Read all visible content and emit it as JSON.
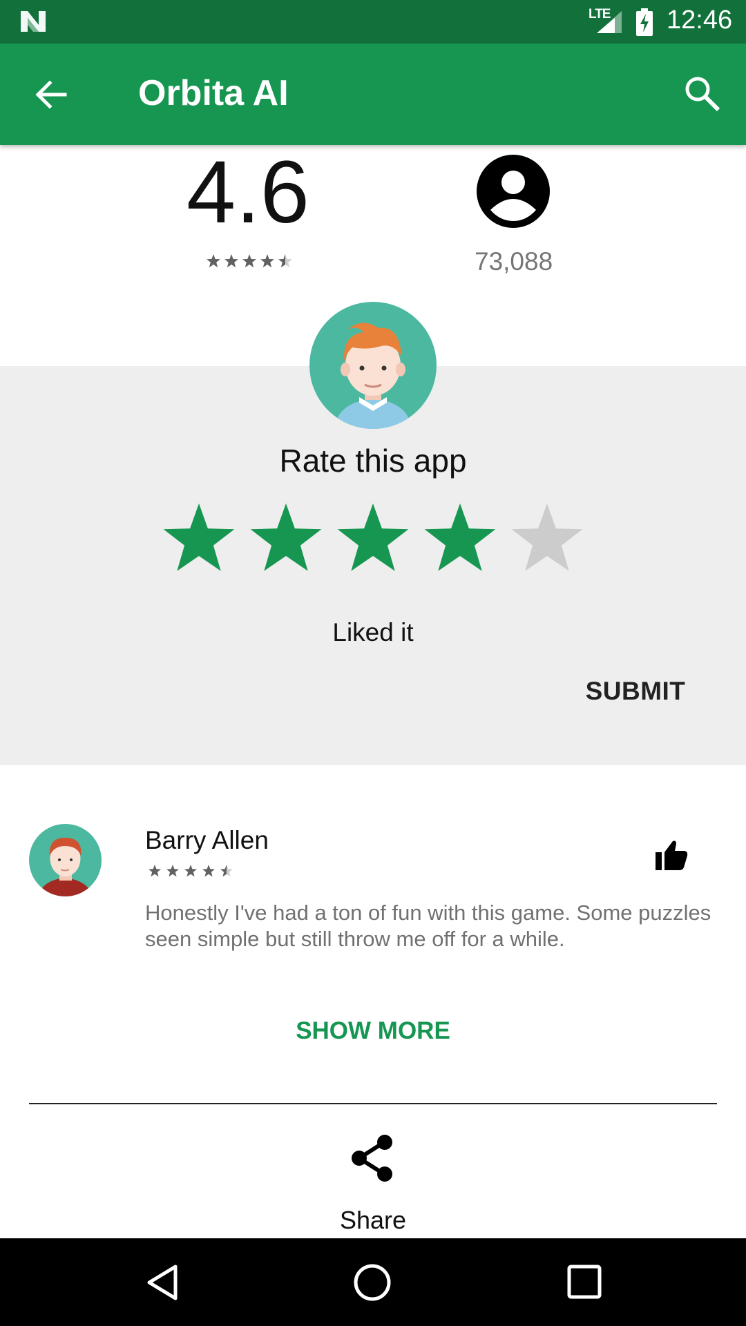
{
  "status_bar": {
    "network": "LTE",
    "time": "12:46",
    "icons": [
      "n-logo-icon",
      "signal-icon",
      "battery-charging-icon"
    ]
  },
  "app_bar": {
    "title": "Orbita AI",
    "icons": [
      "back-arrow-icon",
      "search-icon"
    ]
  },
  "summary": {
    "average_rating": "4.6",
    "average_stars": 4.5,
    "rating_count": "73,088",
    "icons": [
      "account-circle-icon"
    ]
  },
  "rate": {
    "title": "Rate this app",
    "selected_stars": 4,
    "max_stars": 5,
    "result_label": "Liked it",
    "submit_label": "SUBMIT",
    "colors": {
      "star_on": "#169651",
      "star_off": "#cccccc",
      "panel_bg": "#eeeeee"
    }
  },
  "review": {
    "name": "Barry Allen",
    "stars": 4.5,
    "text": "Honestly I've had a ton of fun with this game. Some puzzles seen simple but still throw me off for a while.",
    "icons": [
      "thumb-up-icon"
    ]
  },
  "show_more_label": "SHOW MORE",
  "share": {
    "label": "Share",
    "icon": "share-icon"
  },
  "nav_bar": {
    "icons": [
      "nav-back-icon",
      "nav-home-icon",
      "nav-recents-icon"
    ]
  },
  "colors": {
    "status_bar": "#12713b",
    "app_bar": "#169651",
    "accent": "#169651"
  }
}
